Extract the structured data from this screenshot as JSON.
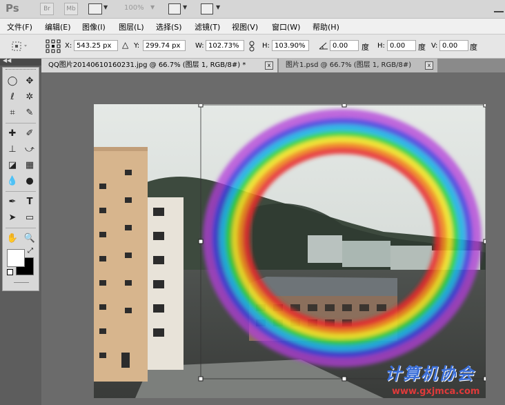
{
  "app": {
    "logo": "Ps"
  },
  "titlebar": {
    "bridge": "Br",
    "minibridge": "Mb",
    "zoom": "100%"
  },
  "menu": [
    "文件(F)",
    "编辑(E)",
    "图像(I)",
    "图层(L)",
    "选择(S)",
    "滤镜(T)",
    "视图(V)",
    "窗口(W)",
    "帮助(H)"
  ],
  "options": {
    "x_label": "X:",
    "x_value": "543.25 px",
    "y_label": "Y:",
    "y_value": "299.74 px",
    "w_label": "W:",
    "w_value": "102.73%",
    "h_label": "H:",
    "h_value": "103.90%",
    "angle_value": "0.00",
    "angle_unit": "度",
    "hskew_label": "H:",
    "hskew_value": "0.00",
    "hskew_unit": "度",
    "vskew_label": "V:",
    "vskew_value": "0.00",
    "vskew_unit": "度"
  },
  "tabs": [
    {
      "label": "QQ图片20140610160231.jpg @ 66.7% (图层 1, RGB/8#) *",
      "close": "x",
      "active": true
    },
    {
      "label": "图片1.psd @ 66.7% (图层 1, RGB/8#)",
      "close": "x",
      "active": false
    }
  ],
  "watermark": {
    "text": "计算机协会",
    "url": "www.gxjmca.com"
  },
  "colors": {
    "foreground": "#ffffff",
    "background": "#000000"
  }
}
